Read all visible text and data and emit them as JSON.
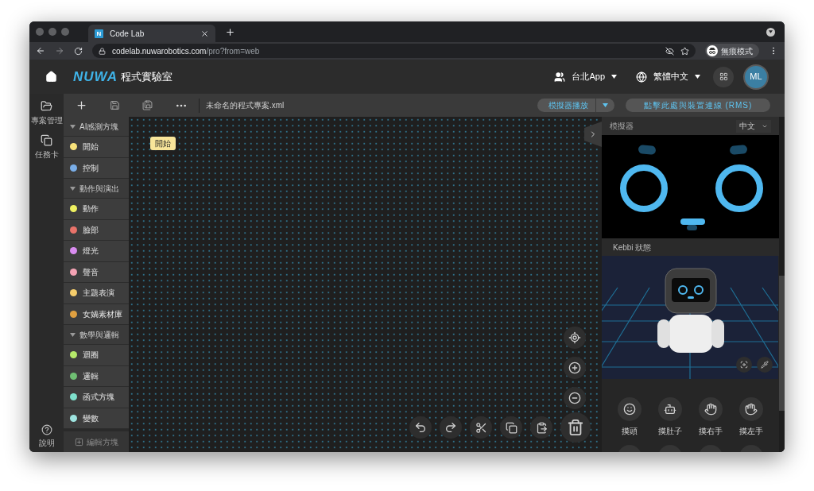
{
  "browser": {
    "tab": {
      "favicon_text": "N",
      "title": "Code Lab"
    },
    "url": {
      "host": "codelab.nuwarobotics.com",
      "path": "/pro?from=web"
    },
    "profile": "無痕模式"
  },
  "header": {
    "logo": "NUWA",
    "product": "程式實驗室",
    "org": "台北App",
    "language": "繁體中文",
    "avatar": "ML"
  },
  "rail": [
    {
      "kind": "folder",
      "label": "專案管理"
    },
    {
      "kind": "cards",
      "label": "任務卡"
    }
  ],
  "help": "說明",
  "toolbar": {
    "filename": "未命名的程式專案.xml",
    "play": "模擬器播放",
    "connect": "點擊此處與裝置連線 (RMS)"
  },
  "categories": [
    {
      "kind": "header",
      "label": "AI感測方塊",
      "expanded": true
    },
    {
      "kind": "item",
      "label": "開始",
      "color": "#f7e17a"
    },
    {
      "kind": "item",
      "label": "控制",
      "color": "#7aaee8"
    },
    {
      "kind": "header",
      "label": "動作與演出",
      "expanded": true
    },
    {
      "kind": "item",
      "label": "動作",
      "color": "#eef060"
    },
    {
      "kind": "item",
      "label": "臉部",
      "color": "#e9736a"
    },
    {
      "kind": "item",
      "label": "燈光",
      "color": "#d98cf0"
    },
    {
      "kind": "item",
      "label": "聲音",
      "color": "#f4a3b4"
    },
    {
      "kind": "item",
      "label": "主題表演",
      "color": "#f5cd6b"
    },
    {
      "kind": "item",
      "label": "女媧素材庫",
      "color": "#e0a040"
    },
    {
      "kind": "header",
      "label": "數學與邏輯",
      "expanded": true
    },
    {
      "kind": "item",
      "label": "迴圈",
      "color": "#b5e96a"
    },
    {
      "kind": "item",
      "label": "邏輯",
      "color": "#6fbf73"
    },
    {
      "kind": "item",
      "label": "函式方塊",
      "color": "#7ee0cc"
    },
    {
      "kind": "item",
      "label": "變數",
      "color": "#9ee4e0"
    }
  ],
  "edit_blocks": "編輯方塊",
  "canvas": {
    "block": "開始"
  },
  "simulator": {
    "title": "模擬器",
    "language": "中文",
    "status_title": "Kebbi 狀態",
    "actions": [
      {
        "kind": "head",
        "label": "摸頭"
      },
      {
        "kind": "belly",
        "label": "摸肚子"
      },
      {
        "kind": "right",
        "label": "摸右手"
      },
      {
        "kind": "left",
        "label": "摸左手"
      }
    ]
  }
}
